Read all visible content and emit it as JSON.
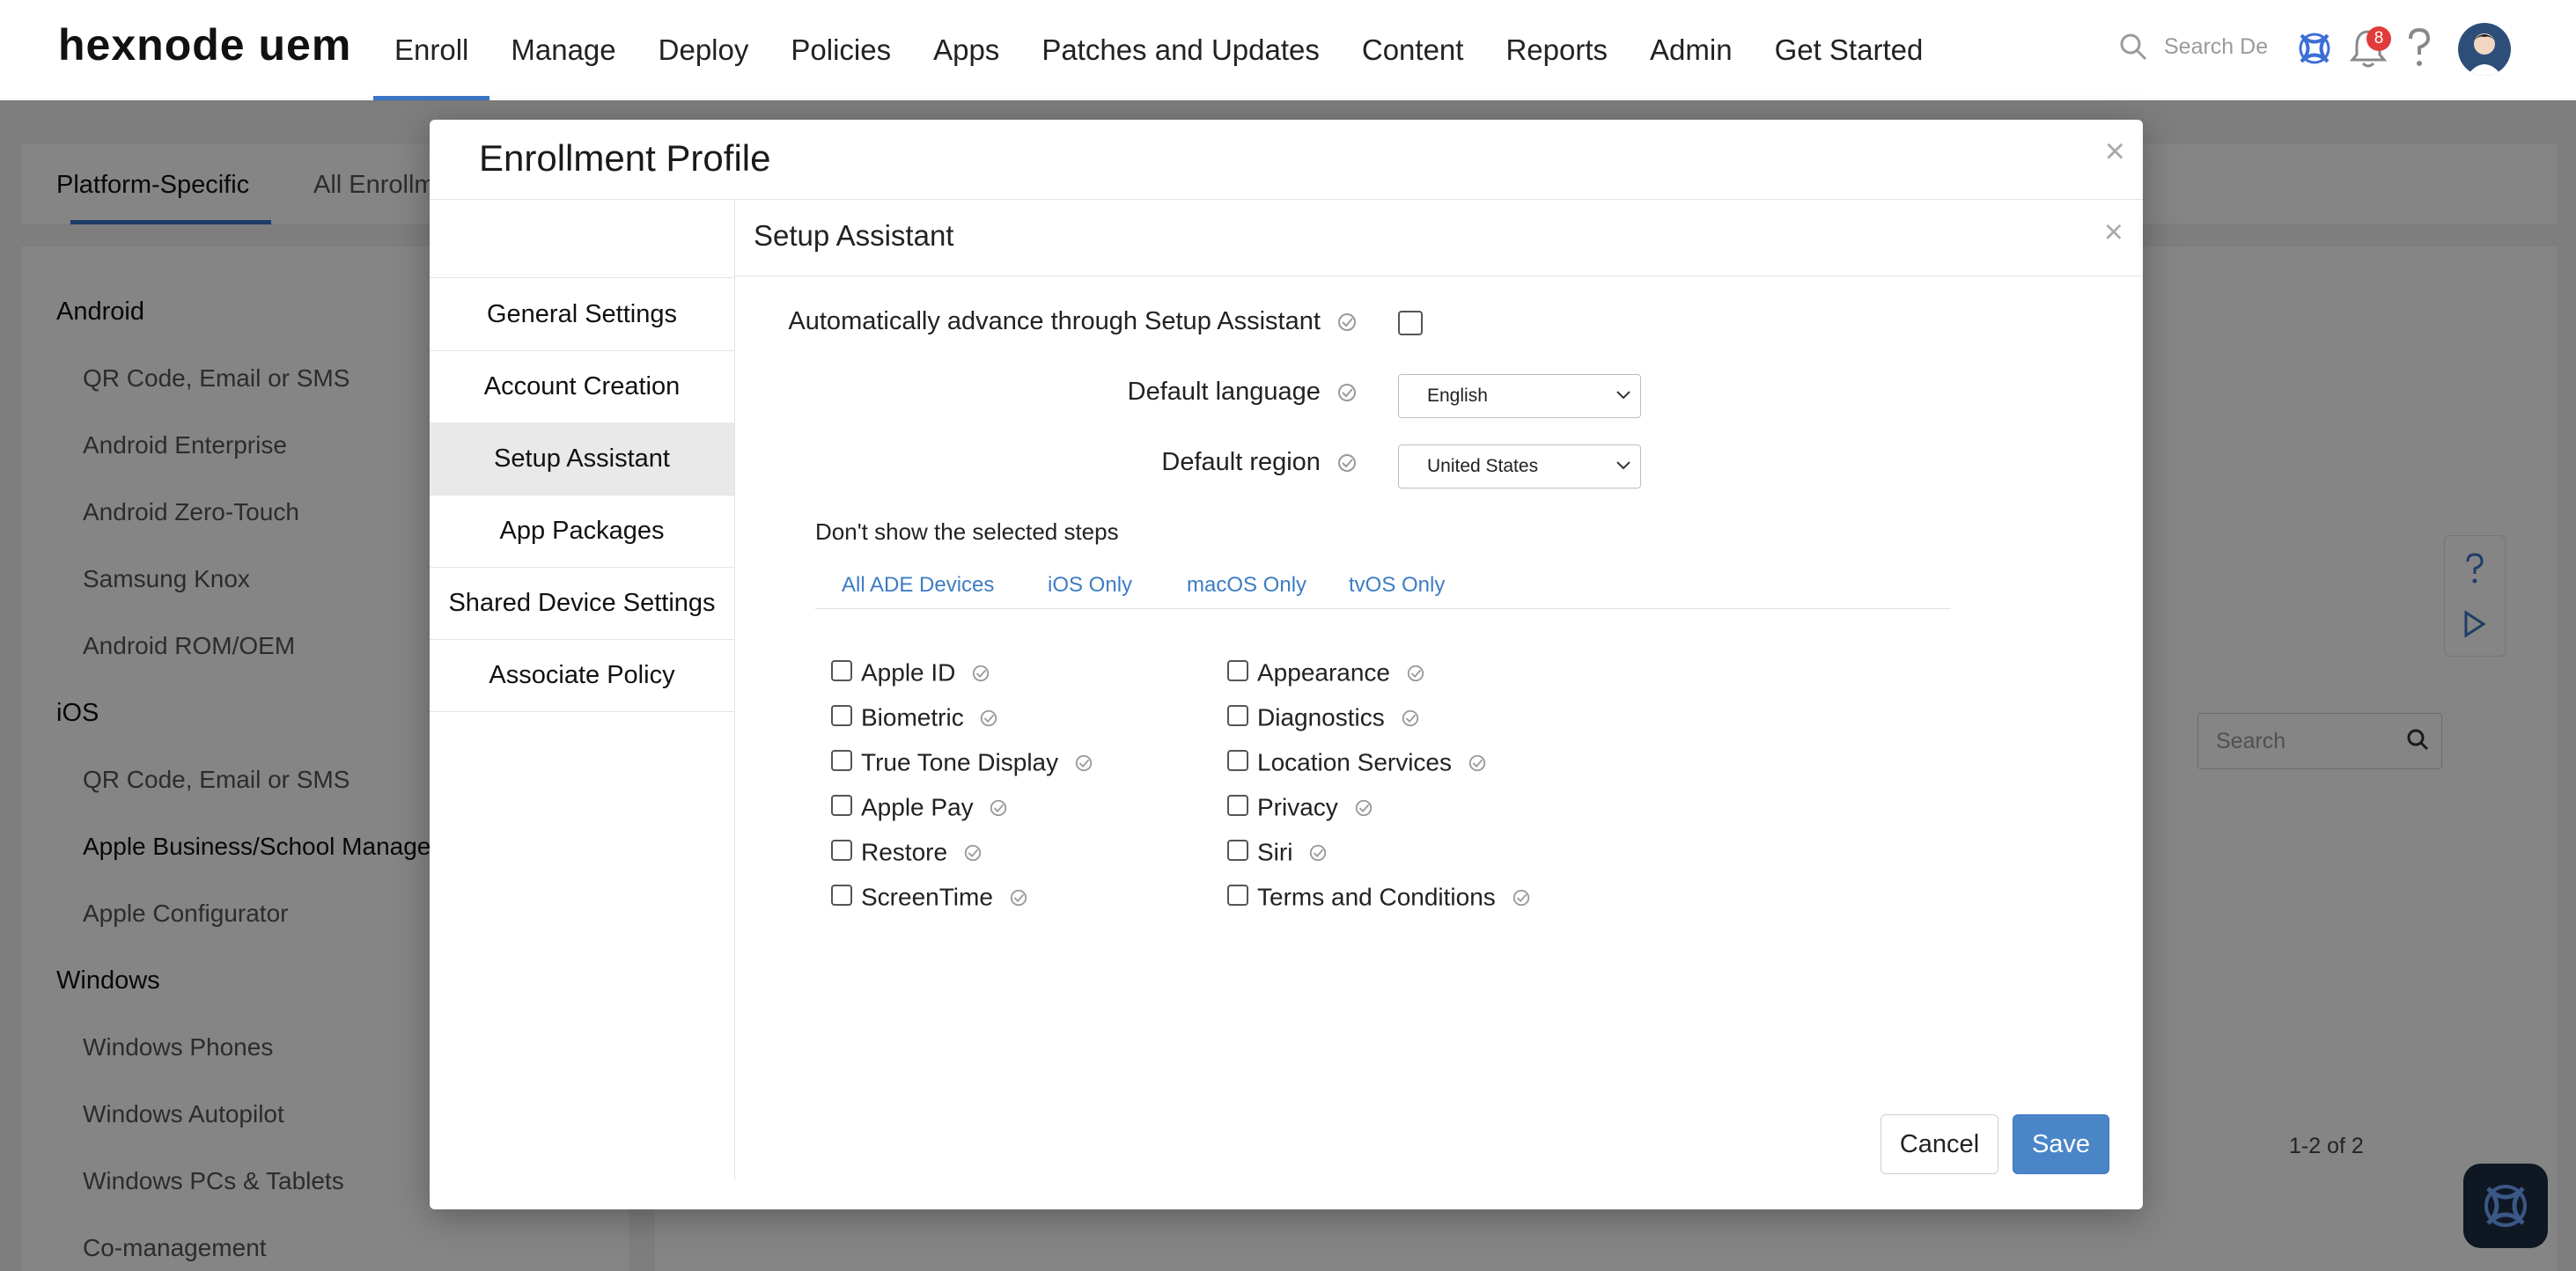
{
  "topnav": {
    "logo": "hexnode uem",
    "items": [
      "Enroll",
      "Manage",
      "Deploy",
      "Policies",
      "Apps",
      "Patches and Updates",
      "Content",
      "Reports",
      "Admin",
      "Get Started"
    ],
    "active_index": 0,
    "search_placeholder": "Search De",
    "notification_count": "8",
    "icons": [
      "search-icon",
      "hexnode-brand-icon",
      "bell-icon",
      "help-icon",
      "avatar"
    ]
  },
  "background": {
    "tabs": [
      "Platform-Specific",
      "All Enrollm"
    ],
    "sidebar": {
      "groups": [
        {
          "label": "Android",
          "items": [
            "QR Code, Email or SMS",
            "Android Enterprise",
            "Android Zero-Touch",
            "Samsung Knox",
            "Android ROM/OEM"
          ]
        },
        {
          "label": "iOS",
          "items": [
            "QR Code, Email or SMS",
            "Apple Business/School Manager",
            "Apple Configurator"
          ]
        },
        {
          "label": "Windows",
          "items": [
            "Windows Phones",
            "Windows Autopilot",
            "Windows PCs & Tablets",
            "Co-management"
          ]
        }
      ],
      "selected_item": "Apple Business/School Manager"
    },
    "search_placeholder": "Search",
    "pagination": "1-2 of 2"
  },
  "modal": {
    "title": "Enrollment Profile",
    "nav": [
      "General Settings",
      "Account Creation",
      "Setup Assistant",
      "App Packages",
      "Shared Device Settings",
      "Associate Policy"
    ],
    "active_nav": "Setup Assistant",
    "section_title": "Setup Assistant",
    "auto_advance_label": "Automatically advance through Setup Assistant",
    "auto_advance_checked": false,
    "default_language_label": "Default language",
    "default_language_value": "English",
    "default_region_label": "Default region",
    "default_region_value": "United States",
    "dont_show_label": "Don't show the selected steps",
    "sub_tabs": [
      "All ADE Devices",
      "iOS Only",
      "macOS Only",
      "tvOS Only"
    ],
    "steps_left": [
      "Apple ID",
      "Biometric",
      "True Tone Display",
      "Apple Pay",
      "Restore",
      "ScreenTime"
    ],
    "steps_right": [
      "Appearance",
      "Diagnostics",
      "Location Services",
      "Privacy",
      "Siri",
      "Terms and Conditions"
    ],
    "cancel_label": "Cancel",
    "save_label": "Save"
  }
}
